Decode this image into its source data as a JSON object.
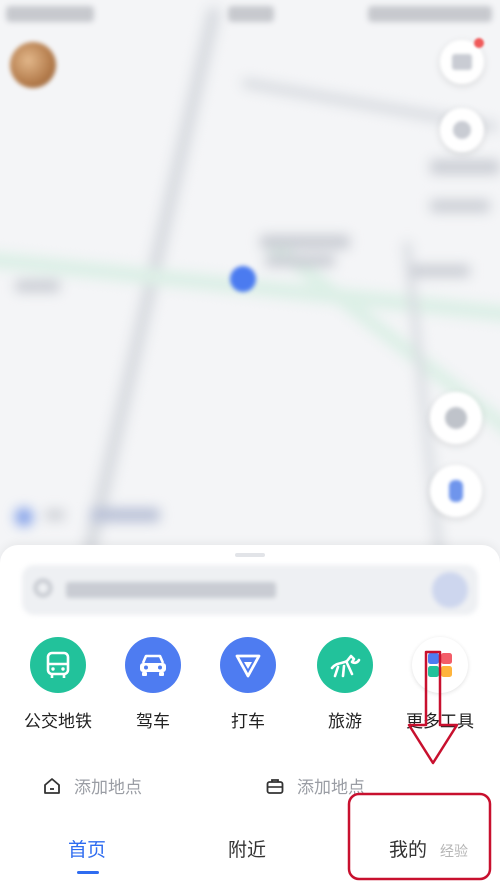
{
  "tools": [
    {
      "id": "transit",
      "label": "公交地铁",
      "color": "#22c29b",
      "icon": "bus-icon"
    },
    {
      "id": "drive",
      "label": "驾车",
      "color": "#4e7cf1",
      "icon": "car-icon"
    },
    {
      "id": "taxi",
      "label": "打车",
      "color": "#4e7cf1",
      "icon": "taxi-icon"
    },
    {
      "id": "travel",
      "label": "旅游",
      "color": "#22c29b",
      "icon": "horse-icon"
    },
    {
      "id": "more",
      "label": "更多工具",
      "color": "#ffffff",
      "icon": "grid-icon"
    }
  ],
  "places": [
    {
      "id": "home",
      "label": "添加地点",
      "icon": "home-icon"
    },
    {
      "id": "work",
      "label": "添加地点",
      "icon": "briefcase-icon"
    }
  ],
  "tabs": [
    {
      "id": "home",
      "label": "首页",
      "active": true
    },
    {
      "id": "nearby",
      "label": "附近",
      "active": false
    },
    {
      "id": "mine",
      "label": "我的",
      "active": false
    }
  ],
  "colors": {
    "accent": "#2f6cf0",
    "annotation": "#c8102e"
  }
}
